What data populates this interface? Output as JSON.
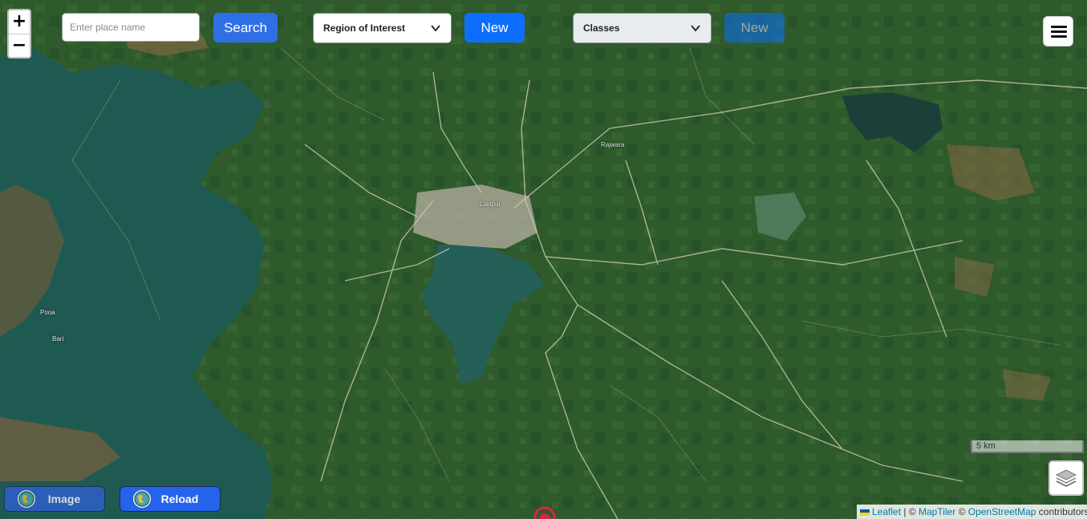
{
  "map": {
    "places": [
      {
        "name": "Lalitpur"
      },
      {
        "name": "Rajwara"
      },
      {
        "name": "Pooa"
      },
      {
        "name": "Bari"
      }
    ],
    "scale_label": "5 km",
    "colors": {
      "vegetation": "#2f5a2e",
      "water": "#1f5a52",
      "urban": "#b8b0a2",
      "marker": "#e0204a"
    }
  },
  "zoom": {
    "in_label": "+",
    "out_label": "−"
  },
  "search": {
    "placeholder": "Enter place name",
    "button_label": "Search"
  },
  "roi": {
    "selected": "Region of Interest",
    "new_label": "New"
  },
  "classes": {
    "selected": "Classes",
    "new_label": "New"
  },
  "menu": {
    "icon": "hamburger-icon"
  },
  "layers": {
    "icon": "layers-icon"
  },
  "bottom": {
    "image_label": "Image",
    "reload_label": "Reload"
  },
  "attribution": {
    "leaflet": "Leaflet",
    "sep1": " | © ",
    "maptiler": "MapTiler",
    "sep2": " © ",
    "osm": "OpenStreetMap",
    "tail": " contributors"
  }
}
